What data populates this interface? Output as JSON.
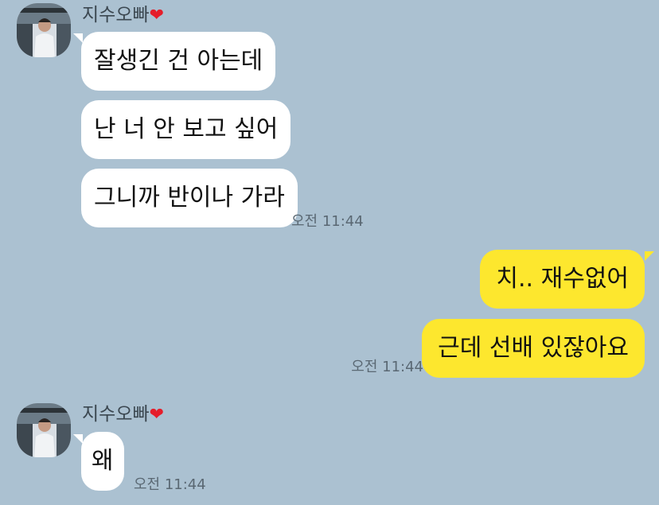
{
  "chat": {
    "contact_name": "지수오빠",
    "contact_emoji": "❤",
    "groups": [
      {
        "messages": [
          "잘생긴 건 아는데",
          "난 너 안 보고 싶어",
          "그니까 반이나 가라"
        ],
        "time": "오전 11:44"
      },
      {
        "messages": [
          "치.. 재수없어",
          "근데 선배 있잖아요"
        ],
        "time": "오전 11:44"
      },
      {
        "messages": [
          "왜"
        ],
        "time": "오전 11:44"
      }
    ]
  },
  "colors": {
    "background": "#abc1d1",
    "incoming_bubble": "#ffffff",
    "outgoing_bubble": "#fde72e",
    "heart": "#e51d2a"
  }
}
